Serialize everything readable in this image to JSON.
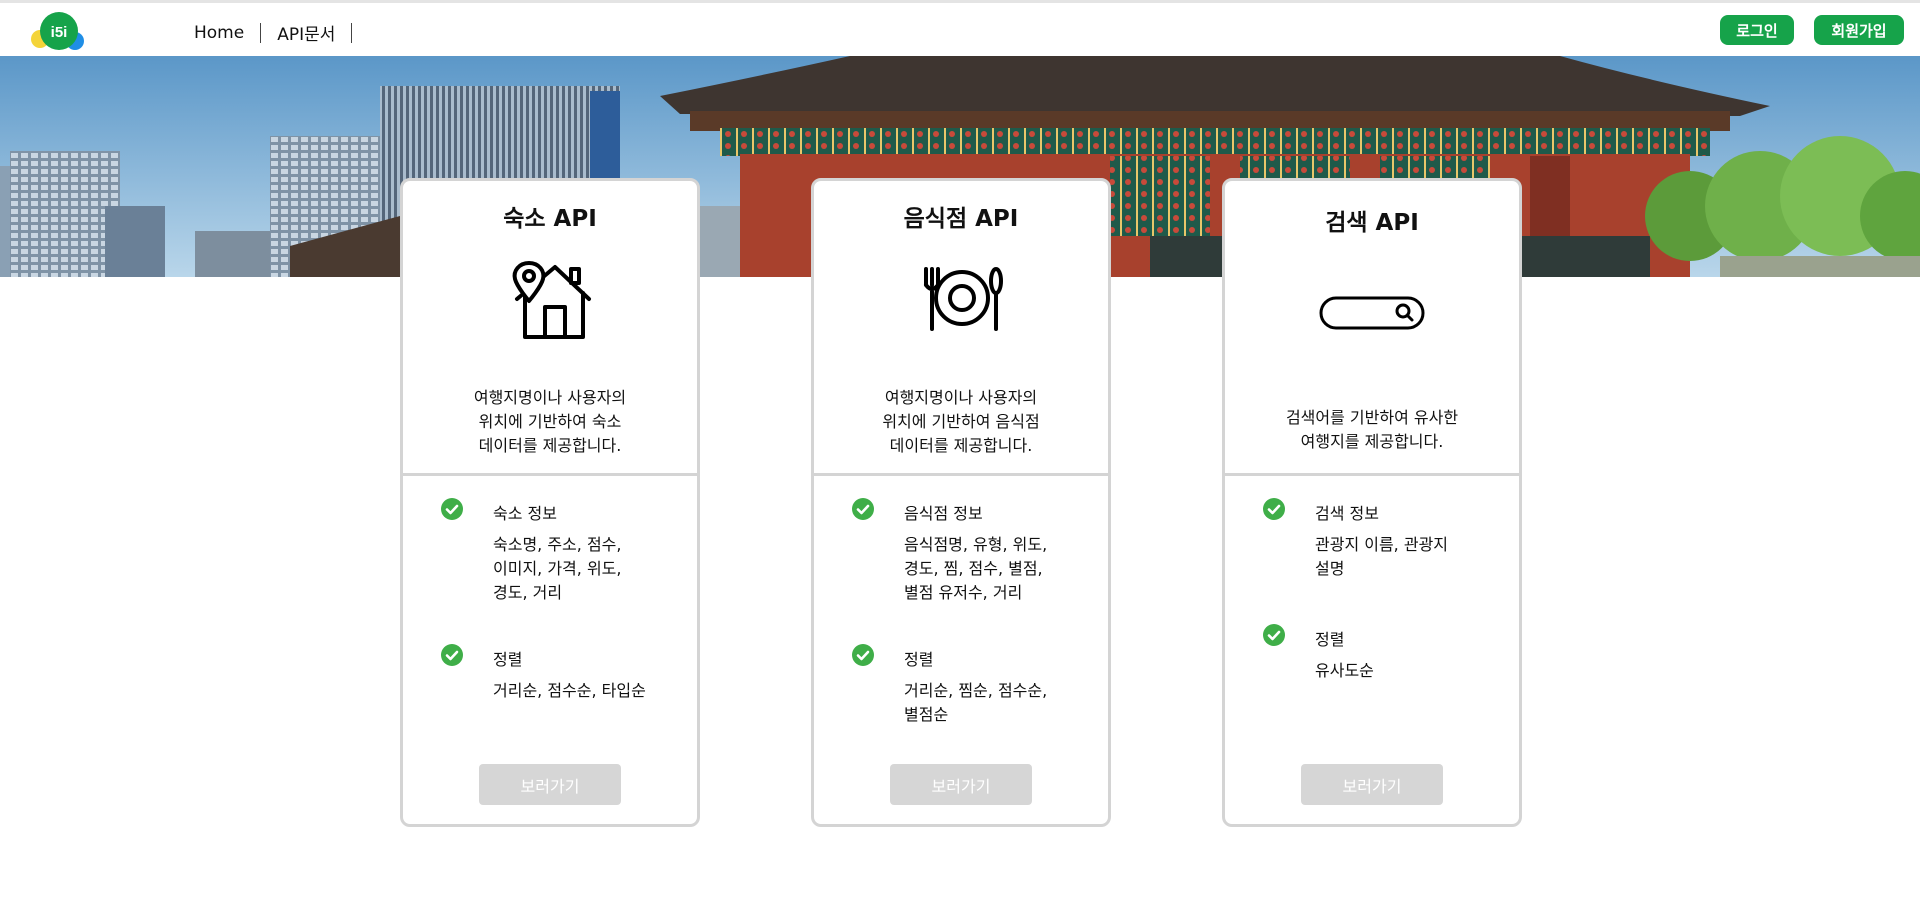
{
  "header": {
    "logo_text": "i5i",
    "nav": [
      {
        "label": "Home"
      },
      {
        "label": "API문서"
      }
    ],
    "login_label": "로그인",
    "signup_label": "회원가입"
  },
  "cards": [
    {
      "title": "숙소 API",
      "icon": "house-location-icon",
      "description": [
        "여행지명이나 사용자의",
        "위치에 기반하여 숙소",
        "데이터를 제공합니다."
      ],
      "features": [
        {
          "title": "숙소 정보",
          "lines": [
            "숙소명, 주소, 점수,",
            "이미지, 가격, 위도,",
            "경도, 거리"
          ]
        },
        {
          "title": "정렬",
          "lines": [
            "거리순, 점수순, 타입순"
          ]
        }
      ],
      "button_label": "보러가기"
    },
    {
      "title": "음식점 API",
      "icon": "plate-utensils-icon",
      "description": [
        "여행지명이나 사용자의",
        "위치에 기반하여 음식점",
        "데이터를 제공합니다."
      ],
      "features": [
        {
          "title": "음식점 정보",
          "lines": [
            "음식점명, 유형, 위도,",
            "경도, 찜, 점수, 별점,",
            "별점 유저수, 거리"
          ]
        },
        {
          "title": "정렬",
          "lines": [
            "거리순, 찜순, 점수순,",
            "별점순"
          ]
        }
      ],
      "button_label": "보러가기"
    },
    {
      "title": "검색 API",
      "icon": "search-bar-icon",
      "description": [
        "검색어를 기반하여 유사한",
        "여행지를 제공합니다."
      ],
      "features": [
        {
          "title": "검색 정보",
          "lines": [
            "관광지 이름, 관광지",
            "설명"
          ]
        },
        {
          "title": "정렬",
          "lines": [
            "유사도순"
          ]
        }
      ],
      "button_label": "보러가기"
    }
  ],
  "colors": {
    "brand_green": "#16a34a",
    "check_green": "#3fae48",
    "button_disabled": "#d6d6d6",
    "card_border": "#d4d4d4"
  }
}
